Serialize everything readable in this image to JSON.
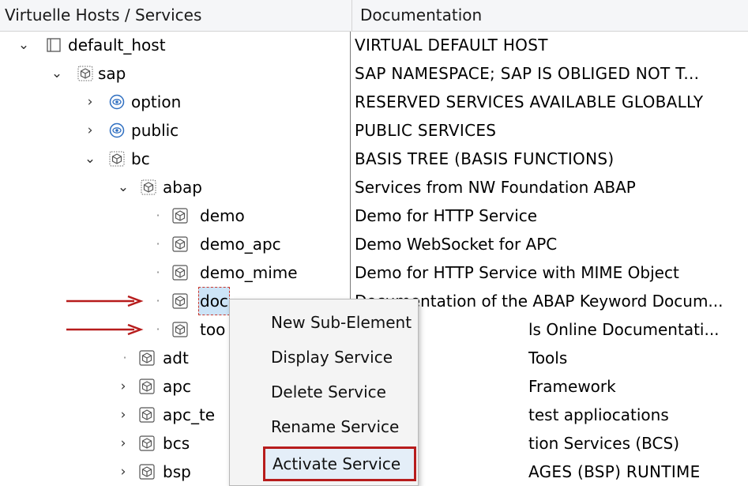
{
  "header": {
    "col1": "Virtuelle Hosts / Services",
    "col2": "Documentation"
  },
  "rows": [
    {
      "name": "default_host",
      "doc": "VIRTUAL DEFAULT HOST",
      "expander": "expanded",
      "icon": "host-icon",
      "level": 0
    },
    {
      "name": "sap",
      "doc": "SAP NAMESPACE; SAP IS OBLIGED NOT T...",
      "expander": "expanded",
      "icon": "service-icon-dotted",
      "level": 1
    },
    {
      "name": "option",
      "doc": "RESERVED SERVICES AVAILABLE GLOBALLY",
      "expander": "collapsed",
      "icon": "service-icon-blue",
      "level": 2
    },
    {
      "name": "public",
      "doc": "PUBLIC SERVICES",
      "expander": "collapsed",
      "icon": "service-icon-blue",
      "level": 2
    },
    {
      "name": "bc",
      "doc": "BASIS TREE (BASIS FUNCTIONS)",
      "expander": "expanded",
      "icon": "service-icon-dotted",
      "level": 2
    },
    {
      "name": "abap",
      "doc": "Services from NW Foundation ABAP",
      "expander": "expanded",
      "icon": "service-icon-dotted",
      "level": 3
    },
    {
      "name": "demo",
      "doc": "Demo for HTTP Service",
      "expander": "leaf",
      "icon": "service-icon",
      "level": 4
    },
    {
      "name": "demo_apc",
      "doc": "Demo WebSocket for APC",
      "expander": "leaf",
      "icon": "service-icon",
      "level": 4
    },
    {
      "name": "demo_mime",
      "doc": "Demo for HTTP Service with MIME Object",
      "expander": "leaf",
      "icon": "service-icon",
      "level": 4
    },
    {
      "name": "doc",
      "doc": "Documentation of the ABAP Keyword Docum...",
      "expander": "leaf",
      "icon": "service-icon",
      "level": 4
    },
    {
      "name": "too",
      "doc": "ls Online Documentati...",
      "expander": "leaf",
      "icon": "service-icon",
      "level": 4
    },
    {
      "name": "adt",
      "doc": "Tools",
      "expander": "leaf",
      "icon": "service-icon",
      "level": 3
    },
    {
      "name": "apc",
      "doc": "Framework",
      "expander": "collapsed",
      "icon": "service-icon",
      "level": 3
    },
    {
      "name": "apc_te",
      "doc": "test appliocations",
      "expander": "collapsed",
      "icon": "service-icon",
      "level": 3
    },
    {
      "name": "bcs",
      "doc": "tion Services (BCS)",
      "expander": "collapsed",
      "icon": "service-icon",
      "level": 3
    },
    {
      "name": "bsp",
      "doc": "AGES (BSP) RUNTIME",
      "expander": "collapsed",
      "icon": "service-icon",
      "level": 3
    }
  ],
  "context_menu": {
    "items": [
      {
        "label": "New Sub-Element"
      },
      {
        "label": "Display Service"
      },
      {
        "label": "Delete Service"
      },
      {
        "label": "Rename Service"
      },
      {
        "label": "Activate Service"
      }
    ]
  },
  "colors": {
    "accent_red": "#b71c1c",
    "header_bg": "#f5f6f8",
    "menu_bg": "#f4f4f4",
    "icon_blue": "#2f6fc1"
  }
}
